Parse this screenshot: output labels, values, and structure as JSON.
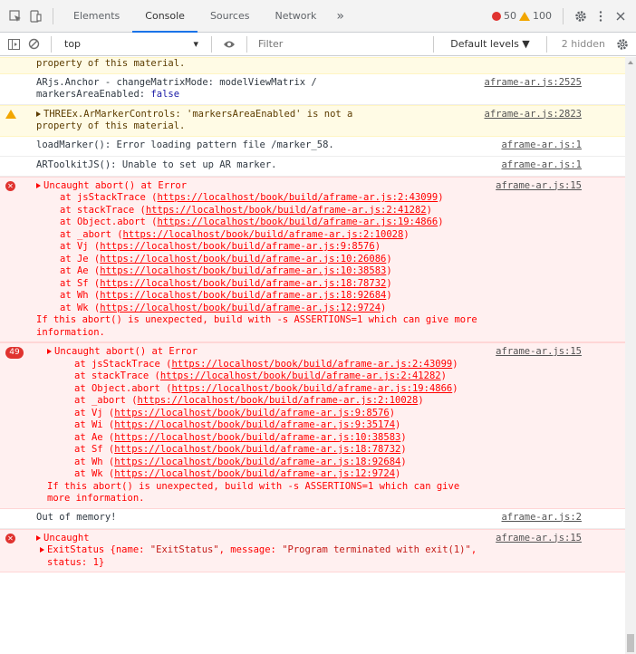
{
  "tabs": {
    "elements": "Elements",
    "console": "Console",
    "sources": "Sources",
    "network": "Network",
    "more": "»"
  },
  "counters": {
    "errors": "50",
    "warnings": "100"
  },
  "toolbar": {
    "context": "top",
    "filter_placeholder": "Filter",
    "levels": "Default levels ▼",
    "hidden": "2 hidden"
  },
  "entries": {
    "e0": {
      "text": "property of this material."
    },
    "e1": {
      "line1": "ARjs.Anchor - changeMatrixMode: modelViewMatrix /",
      "line2a": "markersAreaEnabled: ",
      "line2b": "false",
      "source": "aframe-ar.js:2525"
    },
    "e2": {
      "line1": "THREEx.ArMarkerControls: 'markersAreaEnabled' is not a",
      "line2": "property of this material.",
      "source": "aframe-ar.js:2823"
    },
    "e3": {
      "text": "loadMarker(): Error loading pattern file /marker_58.",
      "source": "aframe-ar.js:1"
    },
    "e4": {
      "text": "ARToolkitJS(): Unable to set up AR marker.",
      "source": "aframe-ar.js:1"
    },
    "e5": {
      "head": "Uncaught abort() at Error",
      "source": "aframe-ar.js:15",
      "stack": [
        {
          "fn": "at jsStackTrace (",
          "url": "https://localhost/book/build/aframe-ar.js:2:43099",
          "end": ")"
        },
        {
          "fn": "at stackTrace (",
          "url": "https://localhost/book/build/aframe-ar.js:2:41282",
          "end": ")"
        },
        {
          "fn": "at Object.abort (",
          "url": "https://localhost/book/build/aframe-ar.js:19:4866",
          "end": ")"
        },
        {
          "fn": "at _abort (",
          "url": "https://localhost/book/build/aframe-ar.js:2:10028",
          "end": ")"
        },
        {
          "fn": "at Vj (",
          "url": "https://localhost/book/build/aframe-ar.js:9:8576",
          "end": ")"
        },
        {
          "fn": "at Je (",
          "url": "https://localhost/book/build/aframe-ar.js:10:26086",
          "end": ")"
        },
        {
          "fn": "at Ae (",
          "url": "https://localhost/book/build/aframe-ar.js:10:38583",
          "end": ")"
        },
        {
          "fn": "at Sf (",
          "url": "https://localhost/book/build/aframe-ar.js:18:78732",
          "end": ")"
        },
        {
          "fn": "at Wh (",
          "url": "https://localhost/book/build/aframe-ar.js:18:92684",
          "end": ")"
        },
        {
          "fn": "at Wk (",
          "url": "https://localhost/book/build/aframe-ar.js:12:9724",
          "end": ")"
        }
      ],
      "tail1": "If this abort() is unexpected, build with -s ASSERTIONS=1 which can give more",
      "tail2": "information."
    },
    "e6": {
      "badge": "49",
      "head": "Uncaught abort() at Error",
      "source": "aframe-ar.js:15",
      "stack": [
        {
          "fn": "at jsStackTrace (",
          "url": "https://localhost/book/build/aframe-ar.js:2:43099",
          "end": ")"
        },
        {
          "fn": "at stackTrace (",
          "url": "https://localhost/book/build/aframe-ar.js:2:41282",
          "end": ")"
        },
        {
          "fn": "at Object.abort (",
          "url": "https://localhost/book/build/aframe-ar.js:19:4866",
          "end": ")"
        },
        {
          "fn": "at _abort (",
          "url": "https://localhost/book/build/aframe-ar.js:2:10028",
          "end": ")"
        },
        {
          "fn": "at Vj (",
          "url": "https://localhost/book/build/aframe-ar.js:9:8576",
          "end": ")"
        },
        {
          "fn": "at Wi (",
          "url": "https://localhost/book/build/aframe-ar.js:9:35174",
          "end": ")"
        },
        {
          "fn": "at Ae (",
          "url": "https://localhost/book/build/aframe-ar.js:10:38583",
          "end": ")"
        },
        {
          "fn": "at Sf (",
          "url": "https://localhost/book/build/aframe-ar.js:18:78732",
          "end": ")"
        },
        {
          "fn": "at Wh (",
          "url": "https://localhost/book/build/aframe-ar.js:18:92684",
          "end": ")"
        },
        {
          "fn": "at Wk (",
          "url": "https://localhost/book/build/aframe-ar.js:12:9724",
          "end": ")"
        }
      ],
      "tail1": "If this abort() is unexpected, build with -s ASSERTIONS=1 which can give",
      "tail2": "more information."
    },
    "e7": {
      "text": "Out of memory!",
      "source": "aframe-ar.js:2"
    },
    "e8": {
      "head": "Uncaught",
      "source": "aframe-ar.js:15",
      "line2a": "ExitStatus {name: ",
      "line2b": "\"ExitStatus\"",
      "line2c": ", message: ",
      "line2d": "\"Program terminated with exit(1)\"",
      "line2e": ",",
      "line3": "status: 1}"
    }
  }
}
